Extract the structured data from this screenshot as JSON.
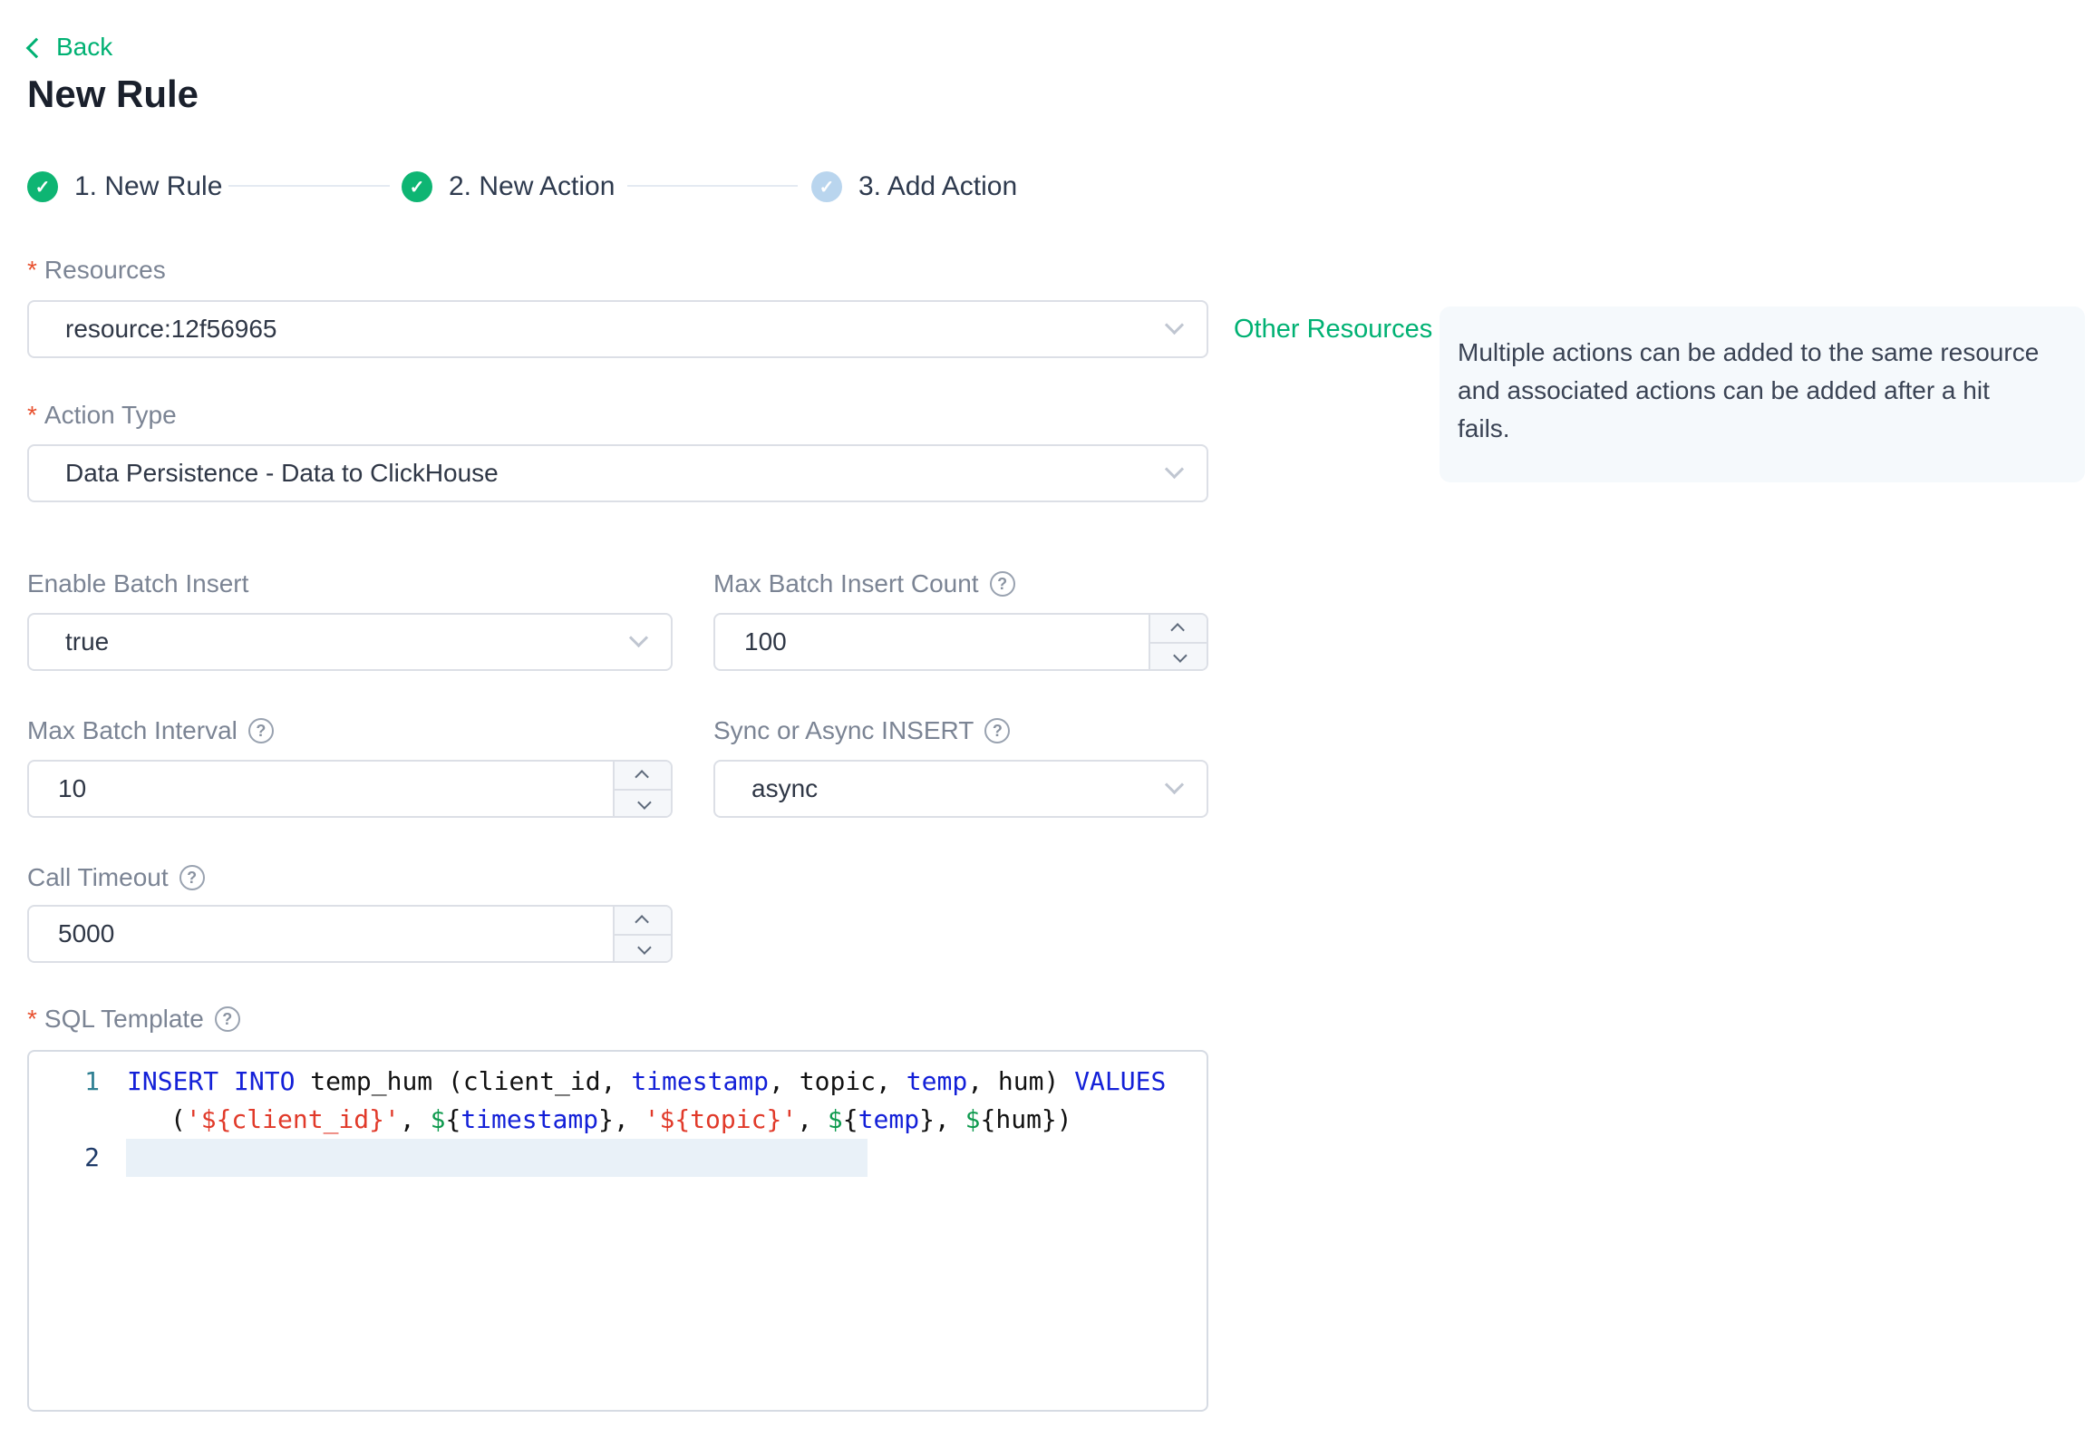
{
  "back": {
    "label": "Back"
  },
  "page": {
    "title": "New Rule"
  },
  "icons": {
    "check": "✓",
    "help": "?"
  },
  "stepper": {
    "steps": [
      {
        "label": "1. New Rule"
      },
      {
        "label": "2. New Action"
      },
      {
        "label": "3. Add Action"
      }
    ]
  },
  "form": {
    "required_marker": "*",
    "resources": {
      "label": "Resources",
      "value": "resource:12f56965"
    },
    "other_resources_label": "Other Resources",
    "info_tip": "Multiple actions can be added to the same resource and associated actions can be added after a hit fails.",
    "action_type": {
      "label": "Action Type",
      "value": "Data Persistence - Data to ClickHouse"
    },
    "enable_batch": {
      "label": "Enable Batch Insert",
      "value": "true"
    },
    "max_count": {
      "label": "Max Batch Insert Count",
      "value": "100"
    },
    "max_interval": {
      "label": "Max Batch Interval",
      "value": "10"
    },
    "sync_async": {
      "label": "Sync or Async INSERT",
      "value": "async"
    },
    "call_timeout": {
      "label": "Call Timeout",
      "value": "5000"
    },
    "sql_template": {
      "label": "SQL Template"
    }
  },
  "sql_editor": {
    "line_numbers": [
      "1",
      "2"
    ],
    "row1": [
      "INSERT INTO",
      " temp_hum (client_id, ",
      "timestamp",
      ", topic, ",
      "temp",
      ", hum) ",
      "VALUES"
    ],
    "row2": [
      "(",
      "'${client_id}'",
      ", ",
      "$",
      "{",
      "timestamp",
      "}",
      ", ",
      "'${topic}'",
      ", ",
      "$",
      "{",
      "temp",
      "}",
      ", ",
      "$",
      "{hum})"
    ]
  }
}
